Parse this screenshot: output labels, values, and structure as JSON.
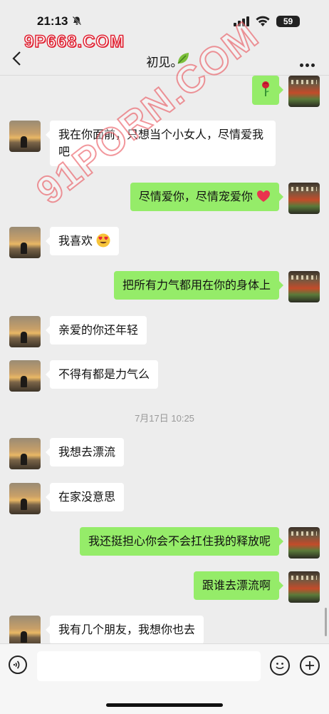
{
  "status_bar": {
    "time": "21:13",
    "battery": "59"
  },
  "watermark": {
    "top": "9P668.COM",
    "diagonal": "91PORN.COM"
  },
  "header": {
    "title": "初见。"
  },
  "messages": [
    {
      "side": "right",
      "text": ""
    },
    {
      "side": "left",
      "text": "我在你面前，只想当个小女人，尽情爱我吧"
    },
    {
      "side": "right",
      "text": "尽情爱你，尽情宠爱你"
    },
    {
      "side": "left",
      "text": "我喜欢"
    },
    {
      "side": "right",
      "text": "把所有力气都用在你的身体上"
    },
    {
      "side": "left",
      "text": "亲爱的你还年轻"
    },
    {
      "side": "left",
      "text": "不得有都是力气么"
    },
    {
      "side": "left",
      "text": "我想去漂流"
    },
    {
      "side": "left",
      "text": "在家没意思"
    },
    {
      "side": "right",
      "text": "我还挺担心你会不会扛住我的释放呢"
    },
    {
      "side": "right",
      "text": "跟谁去漂流啊"
    },
    {
      "side": "left",
      "text": "我有几个朋友，我想你也去"
    }
  ],
  "timestamp": "7月17日 10:25",
  "input": {
    "value": ""
  },
  "colors": {
    "sent_bubble": "#95ec69",
    "received_bubble": "#ffffff",
    "background": "#ededed"
  }
}
